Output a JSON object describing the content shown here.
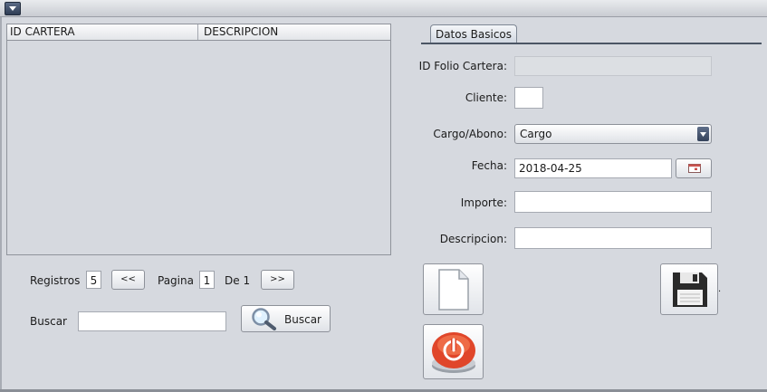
{
  "table": {
    "columns": [
      "ID CARTERA",
      "DESCRIPCION"
    ],
    "rows": []
  },
  "pager": {
    "registros_label": "Registros",
    "registros_value": "5",
    "prev_label": "<<",
    "pagina_label": "Pagina",
    "pagina_value": "1",
    "de_label": "De 1",
    "next_label": ">>"
  },
  "search": {
    "label": "Buscar",
    "value": "",
    "button_label": "Buscar"
  },
  "form": {
    "tab_label": "Datos Basicos",
    "id_folio_label": "ID Folio Cartera:",
    "id_folio_value": "",
    "cliente_label": "Cliente:",
    "cliente_value": "",
    "cargo_label": "Cargo/Abono:",
    "cargo_value": "Cargo",
    "fecha_label": "Fecha:",
    "fecha_value": "2018-04-25",
    "importe_label": "Importe:",
    "importe_value": "",
    "descripcion_label": "Descripcion:",
    "descripcion_value": ""
  },
  "icons": {
    "new": "new-document-icon",
    "save": "floppy-disk-icon",
    "exit": "power-icon",
    "search": "magnifier-icon",
    "calendar": "calendar-icon"
  }
}
